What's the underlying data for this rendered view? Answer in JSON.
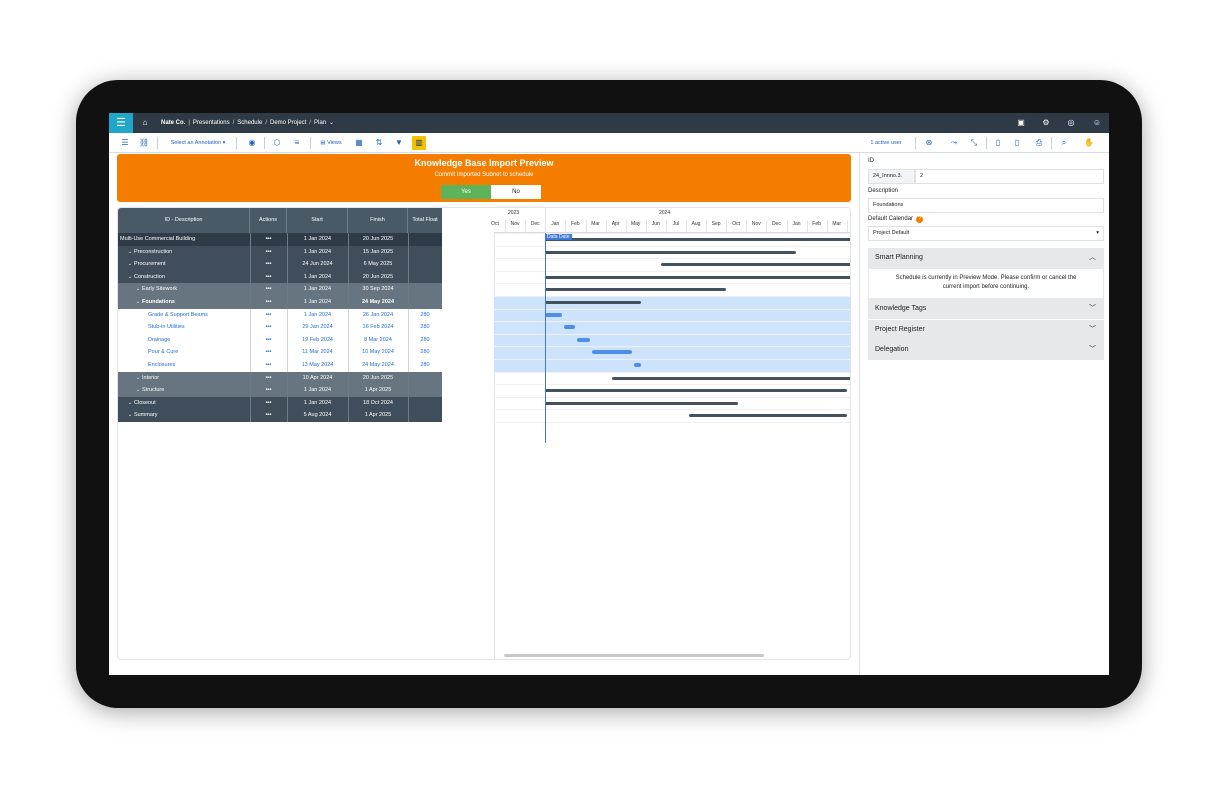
{
  "topbar": {
    "menu_icon": "hamburger-icon",
    "home_icon": "home-icon",
    "crumbs": [
      "Nate Co.",
      "Presentations",
      "Schedule",
      "Demo Project",
      "Plan"
    ],
    "right_icons": [
      "calendar-icon",
      "gear-icon",
      "globe-icon",
      "user-icon"
    ]
  },
  "toolbar": {
    "annotation_label": "Select an Annotation",
    "views_label": "Views",
    "active_users": "1 active user"
  },
  "banner": {
    "title": "Knowledge Base Import Preview",
    "subtitle": "Commit Imported Subnet to schedule",
    "yes": "Yes",
    "no": "No",
    "color": "#f47d00"
  },
  "grid": {
    "headers": [
      "ID - Description",
      "Actions",
      "Start",
      "Finish",
      "Total Float"
    ],
    "rows": [
      {
        "name": "Multi-Use Commercial Building",
        "actions": "•••",
        "start": "1 Jan 2024",
        "finish": "20 Jun 2025",
        "float": ""
      },
      {
        "name": "Preconstruction",
        "actions": "•••",
        "start": "1 Jan 2024",
        "finish": "15 Jan 2025",
        "float": ""
      },
      {
        "name": "Procurement",
        "actions": "•••",
        "start": "24 Jun 2024",
        "finish": "6 May 2025",
        "float": ""
      },
      {
        "name": "Construction",
        "actions": "•••",
        "start": "1 Jan 2024",
        "finish": "20 Jun 2025",
        "float": ""
      },
      {
        "name": "Early Sitework",
        "actions": "•••",
        "start": "1 Jan 2024",
        "finish": "30 Sep 2024",
        "float": ""
      },
      {
        "name": "Foundations",
        "actions": "•••",
        "start": "1 Jan 2024",
        "finish": "24 May 2024",
        "float": ""
      },
      {
        "name": "Grade & Support Beams",
        "actions": "•••",
        "start": "1 Jan 2024",
        "finish": "26 Jan 2024",
        "float": "280"
      },
      {
        "name": "Stub-in Utilities",
        "actions": "•••",
        "start": "29 Jan 2024",
        "finish": "16 Feb 2024",
        "float": "280"
      },
      {
        "name": "Drainage",
        "actions": "•••",
        "start": "19 Feb 2024",
        "finish": "8 Mar 2024",
        "float": "280"
      },
      {
        "name": "Pour & Cure",
        "actions": "•••",
        "start": "11 Mar 2024",
        "finish": "10 May 2024",
        "float": "280"
      },
      {
        "name": "Enclosures",
        "actions": "•••",
        "start": "13 May 2024",
        "finish": "24 May 2024",
        "float": "280"
      },
      {
        "name": "Interior",
        "actions": "•••",
        "start": "10 Apr 2024",
        "finish": "20 Jun 2025",
        "float": ""
      },
      {
        "name": "Structure",
        "actions": "•••",
        "start": "1 Jan 2024",
        "finish": "1 Apr 2025",
        "float": ""
      },
      {
        "name": "Closeout",
        "actions": "•••",
        "start": "1 Jan 2024",
        "finish": "18 Oct 2024",
        "float": ""
      },
      {
        "name": "Summary",
        "actions": "•••",
        "start": "5 Aug 2024",
        "finish": "1 Apr 2025",
        "float": ""
      }
    ]
  },
  "gantt": {
    "years": [
      "2023",
      "2024"
    ],
    "months": [
      "Oct",
      "Nov",
      "Dec",
      "Jan",
      "Feb",
      "Mar",
      "Apr",
      "May",
      "Jun",
      "Jul",
      "Aug",
      "Sep",
      "Oct",
      "Nov",
      "Dec",
      "Jan",
      "Feb",
      "Mar"
    ],
    "data_date_label": "Data Date"
  },
  "panel": {
    "id_label": "ID",
    "id_value": "24_Innno.3.",
    "id_suffix": "2",
    "description_label": "Description",
    "description_value": "Foundations",
    "calendar_label": "Default Calendar",
    "calendar_value": "Project Default",
    "smart_planning": "Smart Planning",
    "smart_planning_msg_1": "Schedule is currently in Preview Mode. Please confirm or cancel the",
    "smart_planning_msg_2": "current import before continuing.",
    "knowledge_tags": "Knowledge Tags",
    "project_register": "Project Register",
    "delegation": "Delegation"
  }
}
